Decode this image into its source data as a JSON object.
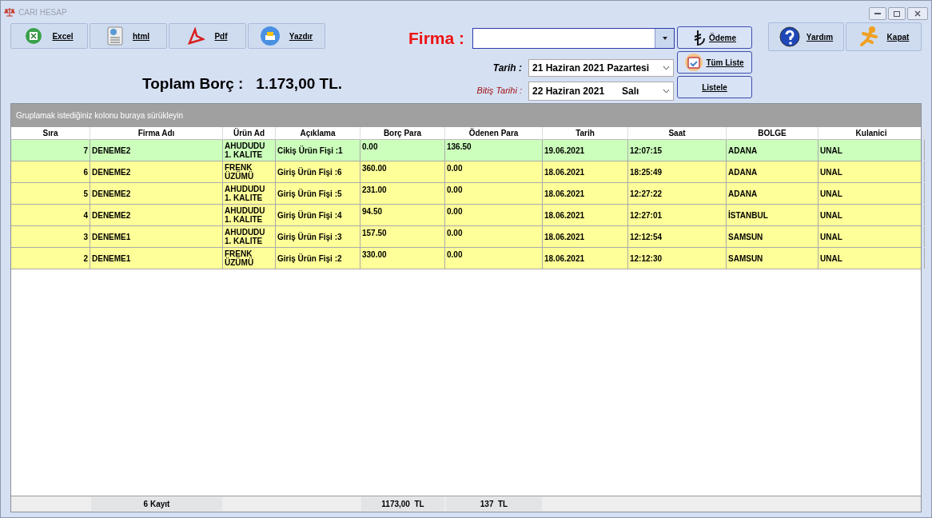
{
  "window": {
    "title": "CARI HESAP"
  },
  "toolbar": [
    {
      "kind": "excel",
      "label": "Excel"
    },
    {
      "kind": "html",
      "label": "html"
    },
    {
      "kind": "pdf",
      "label": "Pdf"
    },
    {
      "kind": "print",
      "label": "Yazdır"
    }
  ],
  "total": {
    "label": "Toplam Borç :",
    "value": "1.173,00 TL."
  },
  "filters": {
    "firma_label": "Firma :",
    "tarih_label": "Tarih :",
    "tarih_value": "21 Haziran 2021 Pazartesi",
    "bitis_label": "Bitiş Tarihi :",
    "bitis_date": "22 Haziran 2021",
    "bitis_day": "Salı"
  },
  "actions": [
    {
      "kind": "lira",
      "label": "Ödeme"
    },
    {
      "kind": "calendar",
      "label": "Tüm Liste"
    },
    {
      "kind": "plain",
      "label": "Listele"
    }
  ],
  "right_buttons": [
    {
      "kind": "help",
      "label": "Yardım"
    },
    {
      "kind": "exit",
      "label": "Kapat"
    }
  ],
  "grid": {
    "group_hint": "Gruplamak istediğiniz kolonu buraya sürükleyin",
    "columns": [
      "Sıra",
      "Firma Adı",
      "Ürün Ad",
      "Açıklama",
      "Borç Para",
      "Ödenen Para",
      "Tarih",
      "Saat",
      "BOLGE",
      "Kulanici"
    ],
    "rows": [
      {
        "color": "#ccffbb",
        "cells": [
          "7",
          "DENEME2",
          "AHUDUDU 1. KALITE",
          "Cikiş Ürün Fişi :1",
          "0.00",
          "136.50",
          "19.06.2021",
          "12:07:15",
          "ADANA",
          "UNAL"
        ]
      },
      {
        "color": "#ffff99",
        "cells": [
          "6",
          "DENEME2",
          "FRENK ÜZÜMÜ",
          "Giriş Ürün Fişi :6",
          "360.00",
          "0.00",
          "18.06.2021",
          "18:25:49",
          "ADANA",
          "UNAL"
        ]
      },
      {
        "color": "#ffff99",
        "cells": [
          "5",
          "DENEME2",
          "AHUDUDU 1. KALITE",
          "Giriş Ürün Fişi :5",
          "231.00",
          "0.00",
          "18.06.2021",
          "12:27:22",
          "ADANA",
          "UNAL"
        ]
      },
      {
        "color": "#ffff99",
        "cells": [
          "4",
          "DENEME2",
          "AHUDUDU 1. KALITE",
          "Giriş Ürün Fişi :4",
          "94.50",
          "0.00",
          "18.06.2021",
          "12:27:01",
          "İSTANBUL",
          "UNAL"
        ]
      },
      {
        "color": "#ffff99",
        "cells": [
          "3",
          "DENEME1",
          "AHUDUDU 1. KALITE",
          "Giriş Ürün Fişi :3",
          "157.50",
          "0.00",
          "18.06.2021",
          "12:12:54",
          "SAMSUN",
          "UNAL"
        ]
      },
      {
        "color": "#ffff99",
        "cells": [
          "2",
          "DENEME1",
          "FRENK ÜZÜMÜ",
          "Giriş Ürün Fişi :2",
          "330.00",
          "0.00",
          "18.06.2021",
          "12:12:30",
          "SAMSUN",
          "UNAL"
        ]
      }
    ],
    "footer": {
      "firma_adi": "6 Kayıt",
      "borc_para": "1173,00  TL",
      "odenen_para": "137  TL"
    }
  }
}
